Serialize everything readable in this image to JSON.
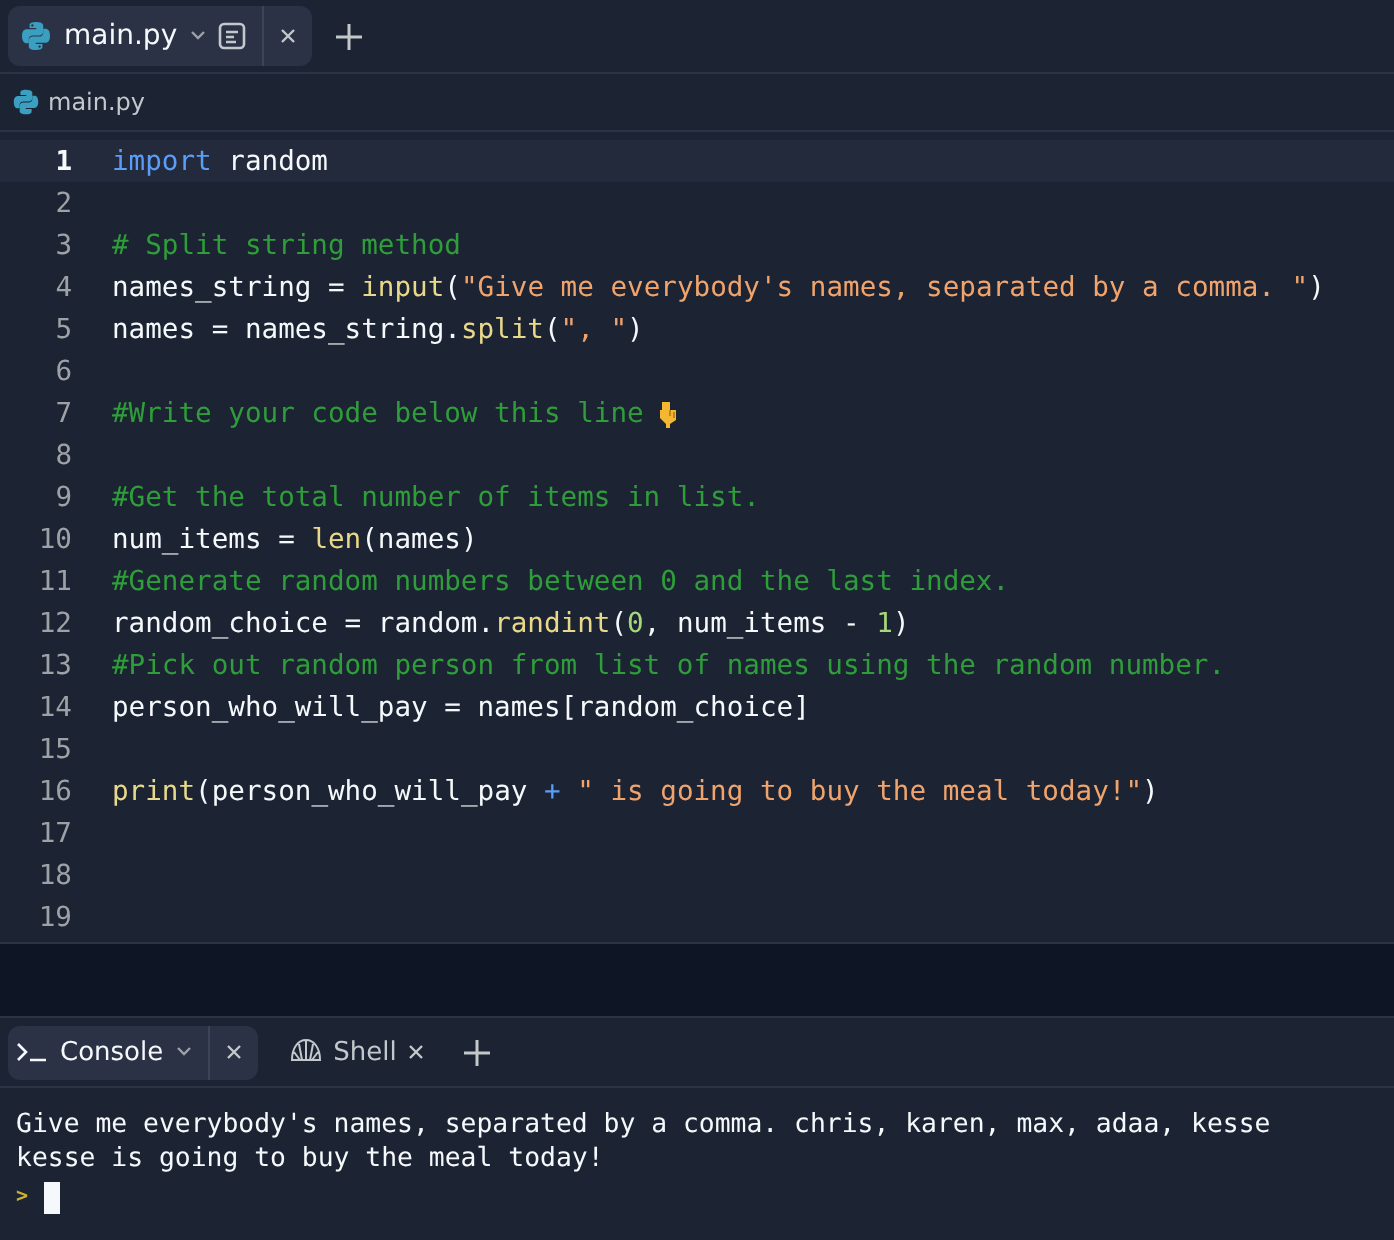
{
  "editor_tabs": [
    {
      "label": "main.py",
      "selected": true,
      "kind": "file"
    }
  ],
  "breadcrumb": "main.py",
  "code_lines": [
    {
      "number": "1",
      "current": true,
      "tokens": [
        {
          "kind": "kw",
          "text": "import"
        },
        {
          "kind": "plain",
          "text": " random"
        }
      ]
    },
    {
      "number": "2",
      "current": false
    },
    {
      "number": "3",
      "current": false,
      "tokens": [
        {
          "kind": "comment",
          "text": "# Split string method"
        }
      ]
    },
    {
      "number": "4",
      "current": false,
      "tokens": [
        {
          "kind": "plain",
          "text": "names_string = "
        },
        {
          "kind": "fn",
          "text": "input"
        },
        {
          "kind": "plain",
          "text": "("
        },
        {
          "kind": "str",
          "text": "\"Give me everybody's names, separated by a comma. \""
        },
        {
          "kind": "plain",
          "text": ")"
        }
      ]
    },
    {
      "number": "5",
      "current": false,
      "tokens": [
        {
          "kind": "plain",
          "text": "names = names_string."
        },
        {
          "kind": "fn",
          "text": "split"
        },
        {
          "kind": "plain",
          "text": "("
        },
        {
          "kind": "str",
          "text": "\", \""
        },
        {
          "kind": "plain",
          "text": ")"
        }
      ]
    },
    {
      "number": "6",
      "current": false
    },
    {
      "number": "7",
      "current": false,
      "tokens": [
        {
          "kind": "comment",
          "text": "#Write your code below this line"
        },
        {
          "kind": "pointer_icon"
        }
      ]
    },
    {
      "number": "8",
      "current": false
    },
    {
      "number": "9",
      "current": false,
      "tokens": [
        {
          "kind": "comment",
          "text": "#Get the total number of items in list."
        }
      ]
    },
    {
      "number": "10",
      "current": false,
      "tokens": [
        {
          "kind": "plain",
          "text": "num_items = "
        },
        {
          "kind": "fn",
          "text": "len"
        },
        {
          "kind": "plain",
          "text": "(names)"
        }
      ]
    },
    {
      "number": "11",
      "current": false,
      "tokens": [
        {
          "kind": "comment",
          "text": "#Generate random numbers between 0 and the last index."
        }
      ]
    },
    {
      "number": "12",
      "current": false,
      "tokens": [
        {
          "kind": "plain",
          "text": "random_choice = random."
        },
        {
          "kind": "fn",
          "text": "randint"
        },
        {
          "kind": "plain",
          "text": "("
        },
        {
          "kind": "num",
          "text": "0"
        },
        {
          "kind": "plain",
          "text": ", num_items - "
        },
        {
          "kind": "num",
          "text": "1"
        },
        {
          "kind": "plain",
          "text": ")"
        }
      ]
    },
    {
      "number": "13",
      "current": false,
      "tokens": [
        {
          "kind": "comment",
          "text": "#Pick out random person from list of names using the random number."
        }
      ]
    },
    {
      "number": "14",
      "current": false,
      "tokens": [
        {
          "kind": "plain",
          "text": "person_who_will_pay = names[random_choice]"
        }
      ]
    },
    {
      "number": "15",
      "current": false
    },
    {
      "number": "16",
      "current": false,
      "tokens": [
        {
          "kind": "fn",
          "text": "print"
        },
        {
          "kind": "plain",
          "text": "(person_who_will_pay "
        },
        {
          "kind": "op",
          "text": "+"
        },
        {
          "kind": "str",
          "text": " \" is going to buy the meal today!\""
        },
        {
          "kind": "plain",
          "text": ")"
        }
      ]
    },
    {
      "number": "17",
      "current": false
    },
    {
      "number": "18",
      "current": false
    },
    {
      "number": "19",
      "current": false
    }
  ],
  "console_tabs": [
    {
      "label": "Console",
      "selected": true,
      "kind": "console"
    },
    {
      "label": "Shell",
      "selected": false,
      "kind": "shell"
    }
  ],
  "console_output": [
    "Give me everybody's names, separated by a comma. chris, karen, max, adaa, kesse",
    "kesse is going to buy the meal today!"
  ],
  "prompt": ">"
}
